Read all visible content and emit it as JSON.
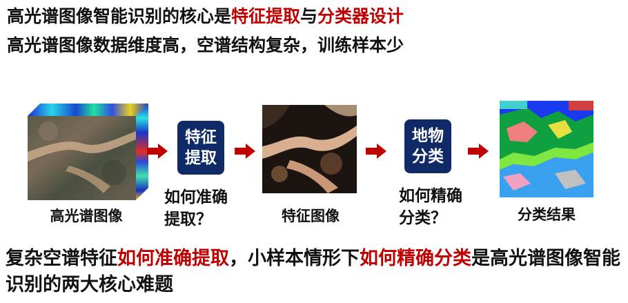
{
  "header": {
    "line1_part1": "高光谱图像智能识别的核心是",
    "line1_part2": "特征提取",
    "line1_part3": "与",
    "line1_part4": "分类器设计",
    "line2": "高光谱图像数据维度高，空谱结构复杂，训练样本少"
  },
  "flow": {
    "cube_caption": "高光谱图像",
    "step1_line1": "特征",
    "step1_line2": "提取",
    "question1_line1": "如何准确",
    "question1_line2": "提取？",
    "feature_caption": "特征图像",
    "step2_line1": "地物",
    "step2_line2": "分类",
    "question2_line1": "如何精确",
    "question2_line2": "分类？",
    "result_caption": "分类结果"
  },
  "footer": {
    "part1": "复杂空谱特征",
    "part2": "如何准确提取",
    "part3": "，小样本情形下",
    "part4": "如何精确分类",
    "part5": "是高光谱图像智能识别的两大核心难题"
  },
  "colors": {
    "accent_red": "#c00000",
    "box_navy": "#0f2a66"
  }
}
